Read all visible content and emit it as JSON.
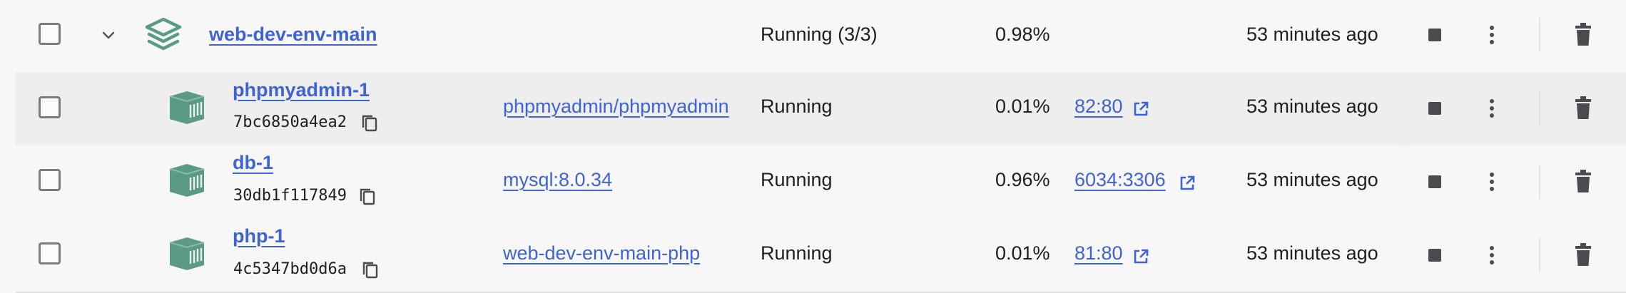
{
  "group": {
    "name": "web-dev-env-main",
    "status": "Running (3/3)",
    "cpu": "0.98%",
    "last_started": "53 minutes ago"
  },
  "containers": [
    {
      "name": "phpmyadmin-1",
      "id": "7bc6850a4ea2",
      "image": "phpmyadmin/phpmyadmin",
      "status": "Running",
      "cpu": "0.01%",
      "port": "82:80",
      "last_started": "53 minutes ago"
    },
    {
      "name": "db-1",
      "id": "30db1f117849",
      "image": "mysql:8.0.34",
      "status": "Running",
      "cpu": "0.96%",
      "port": "6034:3306",
      "last_started": "53 minutes ago"
    },
    {
      "name": "php-1",
      "id": "4c5347bd0d6a",
      "image": "web-dev-env-main-php",
      "status": "Running",
      "cpu": "0.01%",
      "port": "81:80",
      "last_started": "53 minutes ago"
    }
  ],
  "icons": {
    "stack": "stack-icon",
    "container": "container-icon",
    "copy": "copy-icon",
    "external": "external-link-icon",
    "stop": "stop-icon",
    "more": "kebab-menu-icon",
    "delete": "trash-icon",
    "expand": "chevron-down-icon"
  },
  "colors": {
    "accent": "#3f63d2",
    "icon_green": "#5b9a84",
    "row_hover": "#eeeeef"
  }
}
